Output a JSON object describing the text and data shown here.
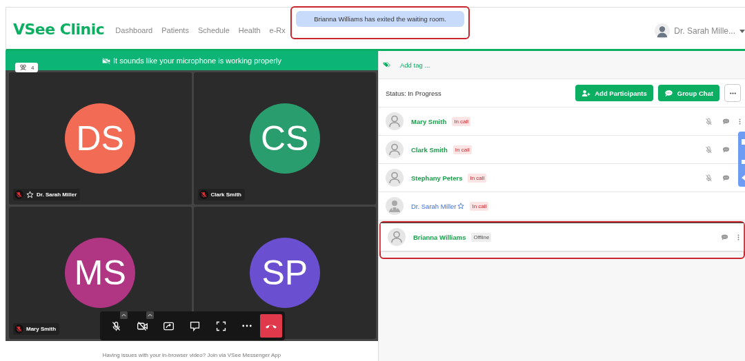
{
  "header": {
    "logo": "VSee Clinic",
    "nav": [
      {
        "label": "Dashboard"
      },
      {
        "label": "Patients"
      },
      {
        "label": "Schedule"
      },
      {
        "label": "Health"
      },
      {
        "label": "e-Rx"
      }
    ],
    "user": "Dr. Sarah Mille..."
  },
  "toast": {
    "message": "Brianna Williams has exited the waiting room.",
    "highlighted": true
  },
  "video": {
    "banner": "It sounds like your microphone is working properly",
    "participant_count": "4",
    "tiles": [
      {
        "initials": "DS",
        "name": "Dr. Sarah Miller",
        "color": "#f26b55",
        "muted": true,
        "host": true
      },
      {
        "initials": "CS",
        "name": "Clark Smith",
        "color": "#2a9d6f",
        "muted": true,
        "host": false
      },
      {
        "initials": "MS",
        "name": "Mary Smith",
        "color": "#b03582",
        "muted": true,
        "host": false
      },
      {
        "initials": "SP",
        "color": "#6a4fd1"
      }
    ],
    "footer": "Having issues with your in-browser video? Join via VSee Messenger App"
  },
  "panel": {
    "add_tag": "Add tag ...",
    "status": "Status: In Progress",
    "buttons": [
      {
        "label": "Add Participants",
        "kind": "add"
      },
      {
        "label": "Group Chat",
        "kind": "chat"
      }
    ],
    "participants": [
      {
        "name": "Mary Smith",
        "badge": "In call",
        "kind": "guest",
        "online": true,
        "highlighted": false
      },
      {
        "name": "Clark Smith",
        "badge": "In call",
        "kind": "guest",
        "online": true,
        "highlighted": false
      },
      {
        "name": "Stephany Peters",
        "badge": "In call",
        "kind": "guest",
        "online": true,
        "highlighted": false
      },
      {
        "name": "Dr. Sarah Miller",
        "badge": "In call",
        "kind": "host",
        "online": true,
        "highlighted": false
      },
      {
        "name": "Brianna Williams",
        "badge": "Offline",
        "kind": "guest",
        "online": false,
        "highlighted": true
      }
    ]
  }
}
